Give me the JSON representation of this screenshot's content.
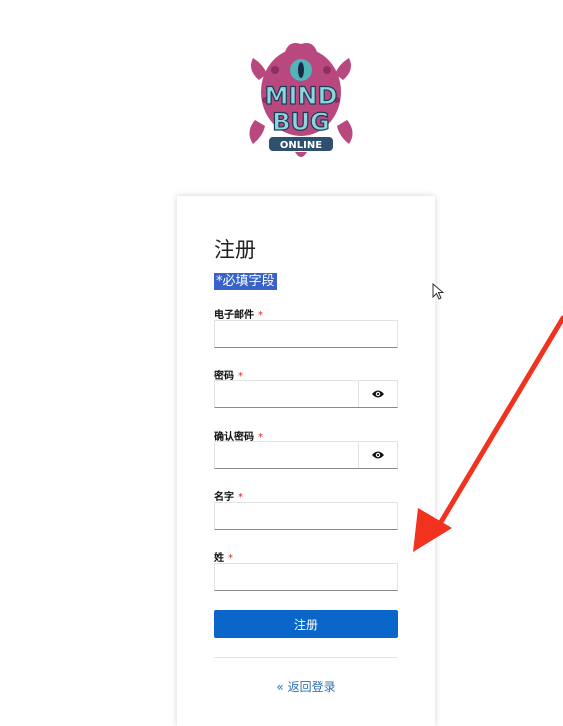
{
  "logo": {
    "alt": "MIND BUG ONLINE",
    "word1": "MIND",
    "word2": "BUG",
    "word3": "ONLINE"
  },
  "form": {
    "title": "注册",
    "required_note": "*必填字段",
    "fields": [
      {
        "label": "电子邮件",
        "required_mark": "*",
        "value": ""
      },
      {
        "label": "密码",
        "required_mark": "*",
        "value": "",
        "toggle_icon": "eye-icon"
      },
      {
        "label": "确认密码",
        "required_mark": "*",
        "value": "",
        "toggle_icon": "eye-icon"
      },
      {
        "label": "名字",
        "required_mark": "*",
        "value": ""
      },
      {
        "label": "姓",
        "required_mark": "*",
        "value": ""
      }
    ],
    "submit_label": "注册",
    "back_link": "« 返回登录"
  },
  "colors": {
    "primary_button": "#0b66c9",
    "required_highlight": "#3a63c9",
    "required_mark": "#dd2222",
    "link": "#2c6fb5",
    "annotation_arrow": "#f0321e"
  }
}
